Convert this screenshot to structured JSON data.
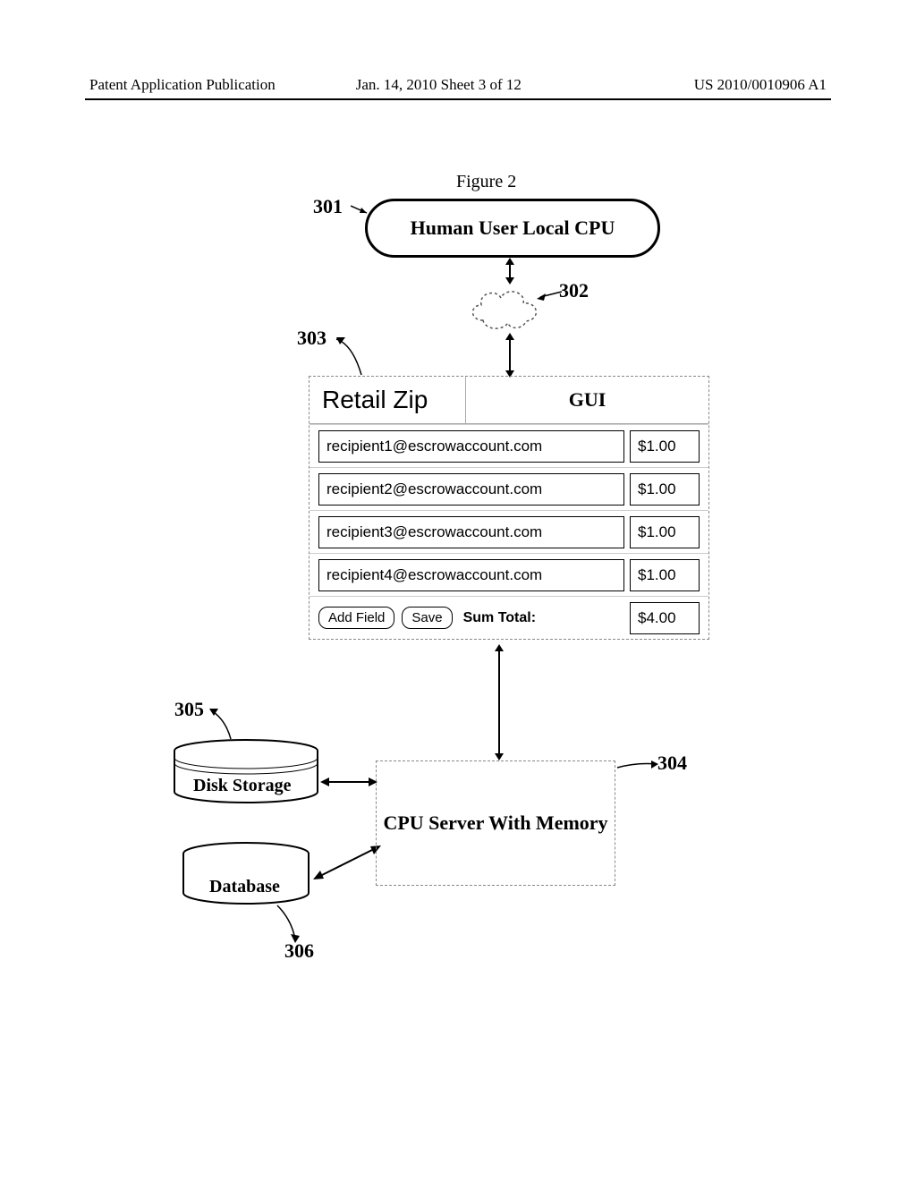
{
  "header": {
    "left": "Patent Application Publication",
    "mid": "Jan. 14, 2010  Sheet 3 of 12",
    "right": "US 2010/0010906 A1"
  },
  "figure": {
    "title": "Figure 2",
    "human_cpu": "Human User Local CPU",
    "gui": {
      "retail": "Retail Zip",
      "label": "GUI",
      "rows": [
        {
          "email": "recipient1@escrowaccount.com",
          "amount": "$1.00"
        },
        {
          "email": "recipient2@escrowaccount.com",
          "amount": "$1.00"
        },
        {
          "email": "recipient3@escrowaccount.com",
          "amount": "$1.00"
        },
        {
          "email": "recipient4@escrowaccount.com",
          "amount": "$1.00"
        }
      ],
      "add_field": "Add Field",
      "save": "Save",
      "sum_label": "Sum Total:",
      "sum_value": "$4.00"
    },
    "server": "CPU Server With Memory",
    "disk": "Disk Storage",
    "db": "Database"
  },
  "refs": {
    "r301": "301",
    "r302": "302",
    "r303": "303",
    "r304": "304",
    "r305": "305",
    "r306": "306"
  }
}
